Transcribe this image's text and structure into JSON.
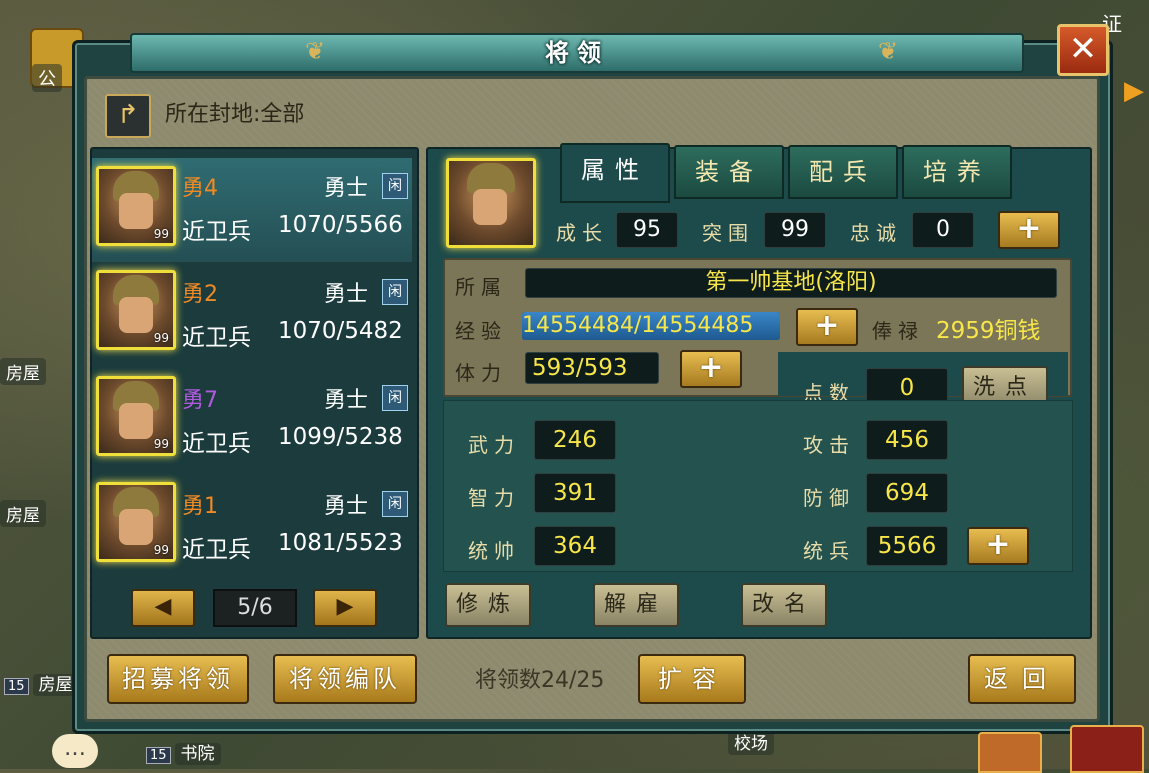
{
  "background": {
    "labels": [
      {
        "lvl": "",
        "text": "公"
      },
      {
        "lvl": "",
        "text": "房屋"
      },
      {
        "lvl": "",
        "text": "房屋"
      },
      {
        "lvl": "15",
        "text": "房屋"
      },
      {
        "lvl": "15",
        "text": "书院"
      },
      {
        "lvl": "",
        "text": "校场"
      }
    ],
    "corner_text": "证"
  },
  "window": {
    "title": "将领",
    "close_label": "✕"
  },
  "territory": {
    "label": "所在封地:全部"
  },
  "generals": [
    {
      "name": "勇4",
      "rank": "勇士",
      "status": "闲",
      "troop": "近卫兵",
      "count": "1070/5566",
      "level": "99",
      "name_color": "orange"
    },
    {
      "name": "勇2",
      "rank": "勇士",
      "status": "闲",
      "troop": "近卫兵",
      "count": "1070/5482",
      "level": "99",
      "name_color": "orange"
    },
    {
      "name": "勇7",
      "rank": "勇士",
      "status": "闲",
      "troop": "近卫兵",
      "count": "1099/5238",
      "level": "99",
      "name_color": "purple"
    },
    {
      "name": "勇1",
      "rank": "勇士",
      "status": "闲",
      "troop": "近卫兵",
      "count": "1081/5523",
      "level": "99",
      "name_color": "orange"
    }
  ],
  "pagination": {
    "page": "5/6",
    "prev": "◀",
    "next": "▶"
  },
  "tabs": [
    "属性",
    "装备",
    "配兵",
    "培养"
  ],
  "detail": {
    "growth_label": "成长",
    "growth": "95",
    "breakout_label": "突围",
    "breakout": "99",
    "loyalty_label": "忠诚",
    "loyalty": "0",
    "belong_label": "所属",
    "belong": "第一帅基地(洛阳)",
    "exp_label": "经验",
    "exp": "14554484/14554485",
    "salary_label": "俸禄",
    "salary": "2959铜钱",
    "stamina_label": "体力",
    "stamina": "593/593",
    "points_label": "点数",
    "points": "0",
    "reset_label": "洗点",
    "stats": {
      "wuli_label": "武力",
      "wuli": "246",
      "zhili_label": "智力",
      "zhili": "391",
      "tongshuai_label": "统帅",
      "tongshuai": "364",
      "gongji_label": "攻击",
      "gongji": "456",
      "fangyu_label": "防御",
      "fangyu": "694",
      "tongbing_label": "统兵",
      "tongbing": "5566"
    },
    "actions": {
      "train": "修炼",
      "dismiss": "解雇",
      "rename": "改名"
    },
    "plus": "+"
  },
  "footer": {
    "recruit": "招募将领",
    "formation": "将领编队",
    "count": "将领数24/25",
    "expand": "扩容",
    "back": "返回"
  },
  "colors": {
    "accent_gold": "#e7bd50",
    "name_orange": "#f08a24",
    "name_purple": "#b05ae0",
    "value_yellow": "#f7e64a"
  }
}
